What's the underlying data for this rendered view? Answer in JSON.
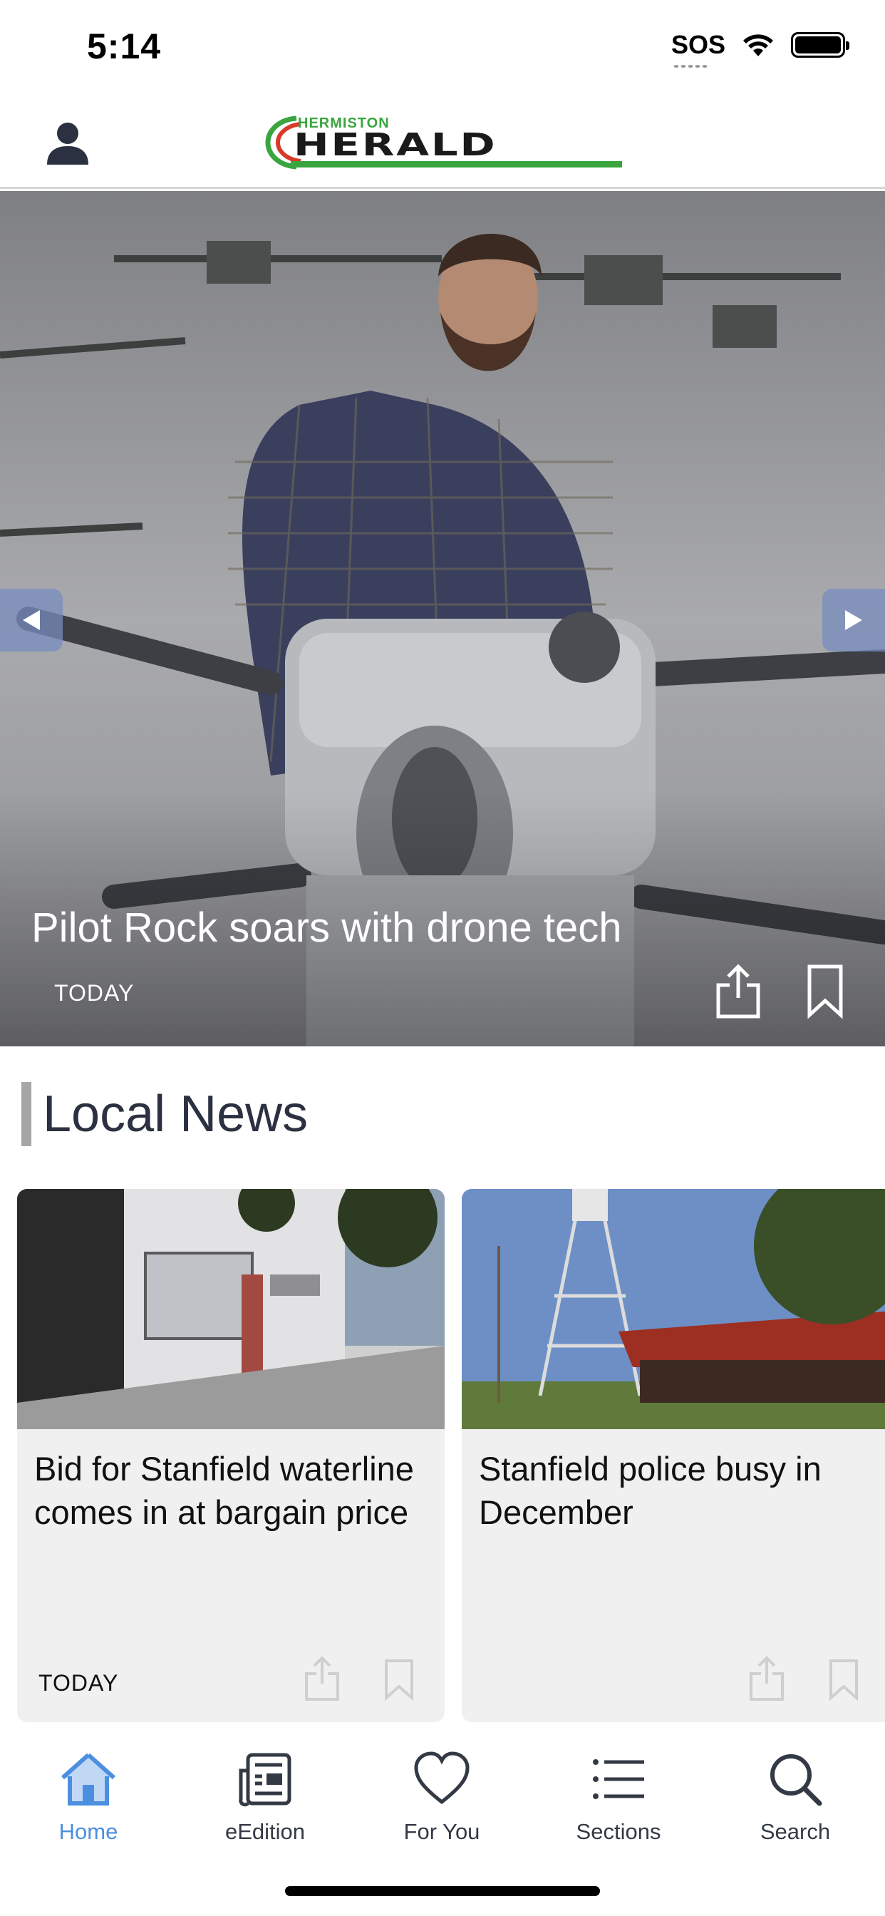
{
  "status_bar": {
    "time": "5:14",
    "sos": "SOS",
    "icons": [
      "wifi-icon",
      "battery-icon"
    ]
  },
  "header": {
    "profile_icon": "person-icon",
    "logo_top": "HERMISTON",
    "logo_main": "HERALD",
    "logo_accent": "#3aa53f"
  },
  "hero": {
    "title": "Pilot Rock soars with drone tech",
    "date": "TODAY",
    "icons": [
      "share-icon",
      "bookmark-icon",
      "chevron-left-icon",
      "chevron-right-icon"
    ]
  },
  "section": {
    "title": "Local News"
  },
  "cards": [
    {
      "headline": "Bid for Stanfield waterline comes in at bargain price",
      "date": "TODAY"
    },
    {
      "headline": "Stanfield police busy in December",
      "date": ""
    }
  ],
  "tab_bar": {
    "active_color": "#4c8fe0",
    "tabs": [
      {
        "label": "Home",
        "icon": "home-icon"
      },
      {
        "label": "eEdition",
        "icon": "newspaper-icon"
      },
      {
        "label": "For You",
        "icon": "heart-icon"
      },
      {
        "label": "Sections",
        "icon": "list-icon"
      },
      {
        "label": "Search",
        "icon": "search-icon"
      }
    ]
  }
}
